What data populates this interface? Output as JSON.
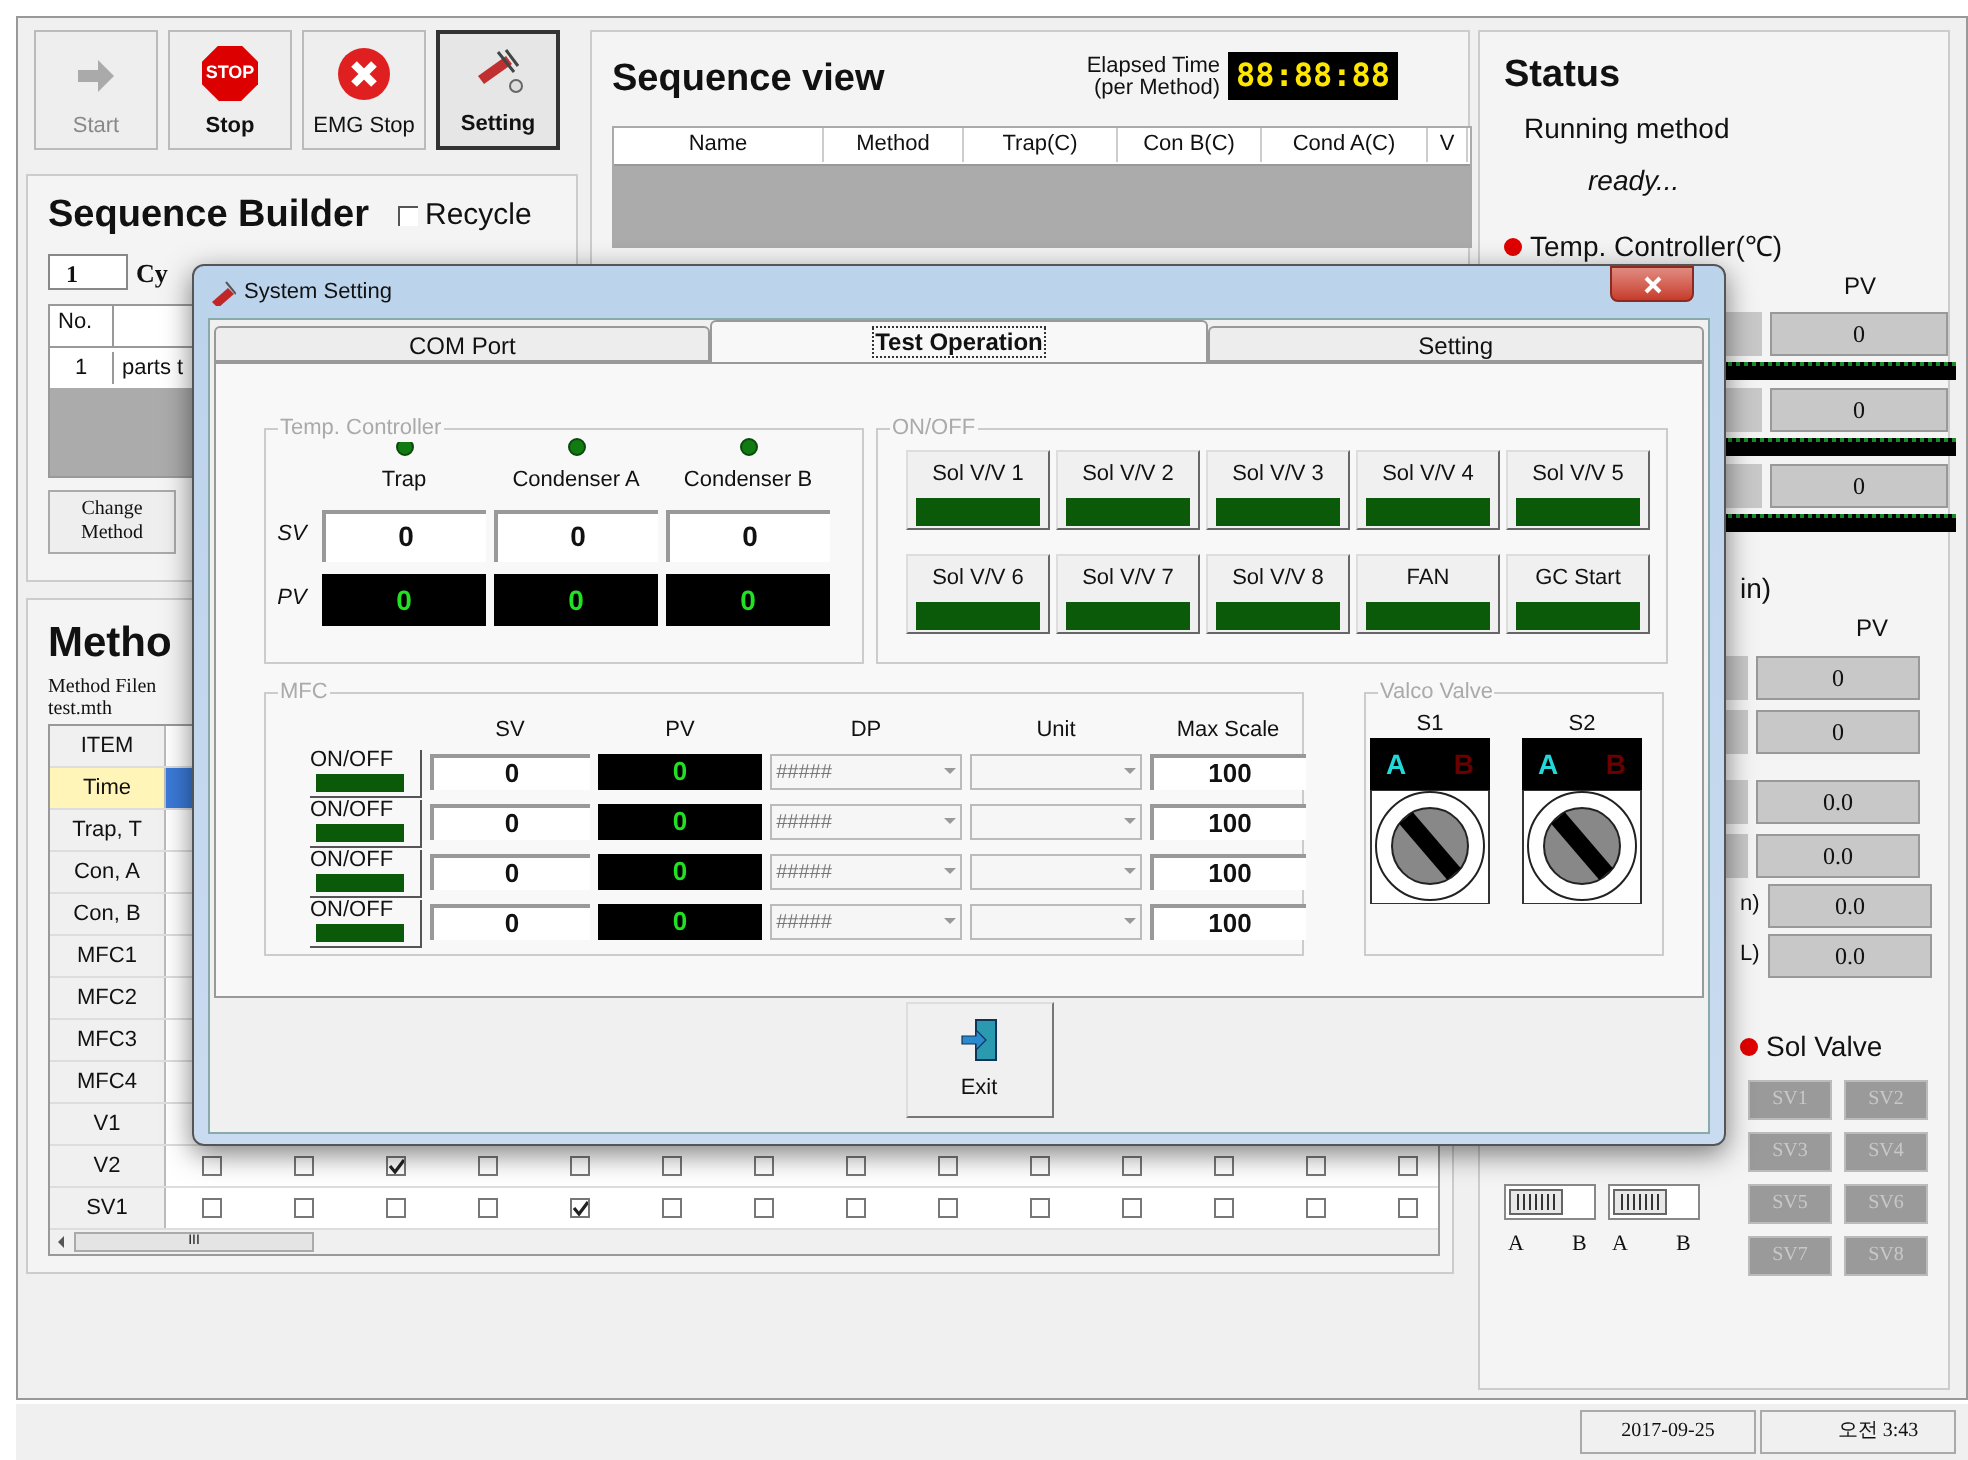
{
  "toolbar": [
    {
      "label": "Start",
      "kind": "start",
      "disabled": true,
      "selected": false
    },
    {
      "label": "Stop",
      "kind": "stop",
      "icon_text": "STOP",
      "disabled": false,
      "selected": false
    },
    {
      "label": "EMG Stop",
      "kind": "emg",
      "disabled": false,
      "selected": false
    },
    {
      "label": "Setting",
      "kind": "setting",
      "disabled": false,
      "selected": true
    }
  ],
  "sequence_builder": {
    "title": "Sequence Builder",
    "recycle": {
      "label": "Recycle",
      "checked": false
    },
    "cycle_value": "1",
    "cycle_label": "Cy",
    "columns": [
      "No."
    ],
    "rows": [
      {
        "no": "1",
        "name": "parts t"
      }
    ],
    "change_button": "Change Method"
  },
  "sequence_view": {
    "title": "Sequence view",
    "elapsed_label": "Elapsed Time",
    "elapsed_sub": "(per Method)",
    "elapsed": "88:88:88",
    "columns": [
      "Name",
      "Method",
      "Trap(C)",
      "Con B(C)",
      "Cond A(C)",
      "V"
    ]
  },
  "method": {
    "title": "Metho",
    "file_label": "Method Filen",
    "file_name": "test.mth",
    "header": "ITEM",
    "rows": [
      {
        "label": "Time",
        "selected": true
      },
      {
        "label": "Trap, T",
        "selected": false
      },
      {
        "label": "Con, A",
        "selected": false
      },
      {
        "label": "Con, B",
        "selected": false
      },
      {
        "label": "MFC1",
        "selected": false
      },
      {
        "label": "MFC2",
        "selected": false
      },
      {
        "label": "MFC3",
        "selected": false
      },
      {
        "label": "MFC4",
        "selected": false
      },
      {
        "label": "V1",
        "selected": false
      },
      {
        "label": "V2",
        "selected": false,
        "checks": [
          false,
          false,
          true,
          false,
          false,
          false,
          false,
          false,
          false,
          false,
          false,
          false,
          false,
          false
        ]
      },
      {
        "label": "SV1",
        "selected": false,
        "checks": [
          false,
          false,
          false,
          false,
          true,
          false,
          false,
          false,
          false,
          false,
          false,
          false,
          false,
          false
        ]
      }
    ],
    "scroll_mark": "III"
  },
  "status": {
    "title": "Status",
    "running_label": "Running method",
    "state": "ready...",
    "temp_title": "Temp. Controller(℃)",
    "temp_pv_label": "PV",
    "temp_values": [
      "0",
      "0",
      "0"
    ],
    "mfc_title": "in)",
    "mfc_pv_label": "PV",
    "mfc_values": [
      "0",
      "0",
      "0.0",
      "0.0"
    ],
    "extra": [
      {
        "label": "n)",
        "value": "0.0"
      },
      {
        "label": "L)",
        "value": "0.0"
      }
    ],
    "sol_title": "Sol Valve",
    "sol_buttons": [
      "SV1",
      "SV2",
      "SV3",
      "SV4",
      "SV5",
      "SV6",
      "SV7",
      "SV8"
    ],
    "switches": [
      {
        "a": "A",
        "b": "B",
        "on": false
      },
      {
        "a": "A",
        "b": "B",
        "on": false
      }
    ]
  },
  "dialog": {
    "title": "System Setting",
    "tabs": [
      {
        "label": "COM Port",
        "selected": false
      },
      {
        "label": "Test Operation",
        "selected": true
      },
      {
        "label": "Setting",
        "selected": false
      }
    ],
    "temp": {
      "title": "Temp. Controller",
      "sv_label": "SV",
      "pv_label": "PV",
      "channels": [
        {
          "name": "Trap",
          "sv": "0",
          "pv": "0"
        },
        {
          "name": "Condenser A",
          "sv": "0",
          "pv": "0"
        },
        {
          "name": "Condenser B",
          "sv": "0",
          "pv": "0"
        }
      ]
    },
    "onoff": {
      "title": "ON/OFF",
      "buttons": [
        "Sol V/V 1",
        "Sol V/V 2",
        "Sol V/V 3",
        "Sol V/V 4",
        "Sol V/V 5",
        "Sol V/V 6",
        "Sol V/V 7",
        "Sol V/V 8",
        "FAN",
        "GC Start"
      ]
    },
    "mfc": {
      "title": "MFC",
      "headers": [
        "SV",
        "PV",
        "DP",
        "Unit",
        "Max Scale"
      ],
      "rows": [
        {
          "toggle": "ON/OFF",
          "sv": "0",
          "pv": "0",
          "dp": "#####",
          "max": "100"
        },
        {
          "toggle": "ON/OFF",
          "sv": "0",
          "pv": "0",
          "dp": "#####",
          "max": "100"
        },
        {
          "toggle": "ON/OFF",
          "sv": "0",
          "pv": "0",
          "dp": "#####",
          "max": "100"
        },
        {
          "toggle": "ON/OFF",
          "sv": "0",
          "pv": "0",
          "dp": "#####",
          "max": "100"
        }
      ]
    },
    "valco": {
      "title": "Valco Valve",
      "valves": [
        {
          "name": "S1",
          "a": "A",
          "b": "B"
        },
        {
          "name": "S2",
          "a": "A",
          "b": "B"
        }
      ]
    },
    "exit": "Exit"
  },
  "status_bar": {
    "date": "2017-09-25",
    "time": "오전 3:43"
  }
}
